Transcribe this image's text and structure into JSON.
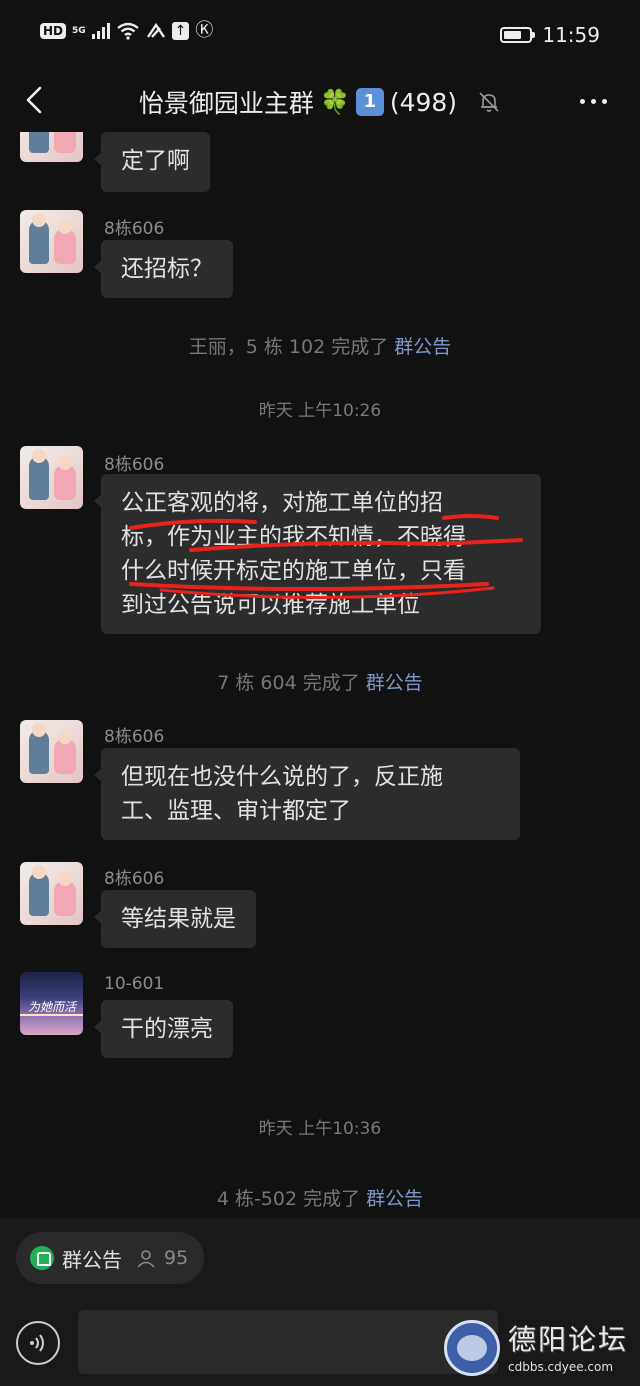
{
  "status_bar": {
    "hd": "HD",
    "signal": "5G",
    "up_glyph": "↑",
    "k_glyph": "Ⓚ",
    "battery_level": 0.72,
    "time": "11:59"
  },
  "nav": {
    "title": "怡景御园业主群",
    "title_emoji": "🍀",
    "badge": "1",
    "count": "(498)",
    "back_icon": "chevron-left-icon",
    "mute_icon": "bell-off-icon",
    "more_icon": "more-icon"
  },
  "messages": {
    "m1": {
      "text": "定了啊"
    },
    "m2": {
      "sender": "8栋606",
      "text": "还招标？"
    },
    "sys1": {
      "text": "王丽，5 栋 102 完成了 ",
      "link": "群公告"
    },
    "ts1": "昨天 上午10:26",
    "m3": {
      "sender": "8栋606",
      "lines": [
        "公正客观的将，对施工单位的招",
        "标，作为业主的我不知情，不晓得",
        "什么时候开标定的施工单位，只看",
        "到过公告说可以推荐施工单位"
      ]
    },
    "sys2": {
      "text": "7 栋 604 完成了 ",
      "link": "群公告"
    },
    "m4": {
      "sender": "8栋606",
      "lines": [
        "但现在也没什么说的了，反正施",
        "工、监理、审计都定了"
      ]
    },
    "m5": {
      "sender": "8栋606",
      "text": "等结果就是"
    },
    "m6": {
      "sender": "10-601",
      "text": "干的漂亮",
      "avatar_text": "为她而活"
    },
    "ts2": "昨天 上午10:36",
    "sys3": {
      "text": "4 栋-502 完成了 ",
      "link": "群公告"
    }
  },
  "bottom": {
    "announce_label": "群公告",
    "announce_count": "95",
    "voice_icon": "voice-icon"
  },
  "watermark": {
    "brand": "德阳论坛",
    "url": "cdbbs.cdyee.com",
    "seal_text": "德阳论坛"
  },
  "colors": {
    "background": "#111111",
    "bubble": "#2c2c2c",
    "link": "#7e97c9",
    "highlight": "#e8231c",
    "badge": "#5b8fd6",
    "announce_green": "#22b056"
  }
}
